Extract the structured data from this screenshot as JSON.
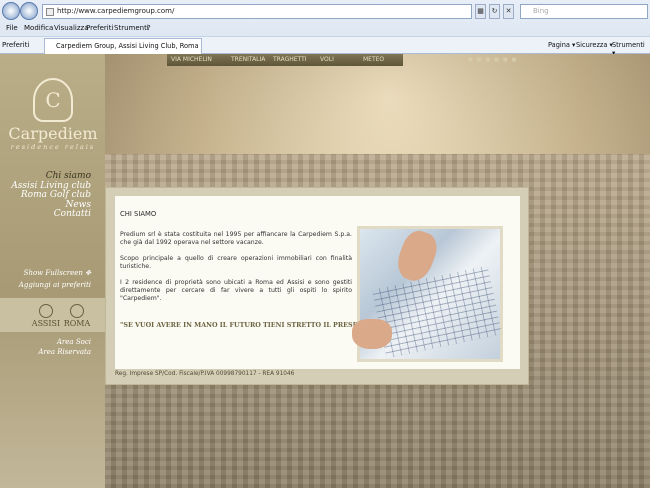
{
  "browser": {
    "address": "http://www.carpediemgroup.com/",
    "search_placeholder": "Bing",
    "menu": [
      "File",
      "Modifica",
      "Visualizza",
      "Preferiti",
      "Strumenti",
      "?"
    ],
    "favorites_label": "Preferiti",
    "tab_title": "Carpediem Group, Assisi Living Club, Roma Golf Club, ...",
    "tools": [
      "Pagina ▾",
      "Sicurezza ▾",
      "Strumenti ▾"
    ]
  },
  "site": {
    "logo_letter": "C",
    "logo_name": "Carpediem",
    "logo_sub": "residence relais",
    "nav": [
      "Chi siamo",
      "Assisi Living club",
      "Roma Golf club",
      "News",
      "Contatti"
    ],
    "show_fullscreen": "Show Fullscreen",
    "add_favorites": "Aggiungi ai preferiti",
    "brand_assisi": "ASSISI",
    "brand_roma": "ROMA",
    "area_soci": "Area Soci",
    "area_riservata": "Area Riservata",
    "topnav": [
      "VIA MICHELIN",
      "TRENITALIA",
      "TRAGHETTI",
      "VOLI",
      "METEO"
    ],
    "content": {
      "heading": "CHI SIAMO",
      "p1": "Predium srl è stata costituita nel 1995 per affiancare la Carpediem S.p.a. che già dal 1992 operava nel settore vacanze.",
      "p2": "Scopo principale a quello di creare operazioni immobiliari con finalità turistiche.",
      "p3": "I 2 residence di proprietà sono ubicati a Roma ed Assisi e sono gestiti direttamente per cercare di far vivere a tutti gli ospiti lo spirito \"Carpediem\".",
      "quote": "\"SE VUOI AVERE IN MANO IL FUTURO TIENI STRETTO IL PRESENTE\"",
      "footer": "Reg. Imprese SP/Cod. Fiscale/P.IVA 00998790117 - REA 91046"
    }
  }
}
